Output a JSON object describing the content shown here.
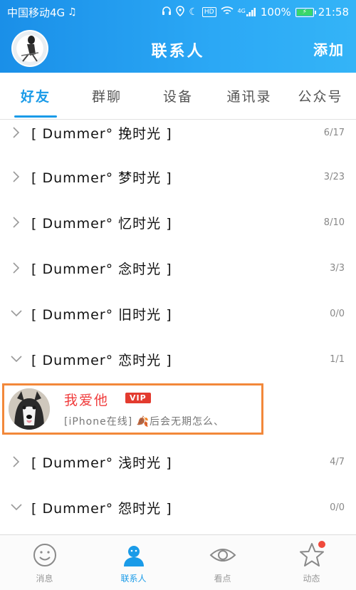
{
  "status_bar": {
    "carrier": "中国移动4G",
    "music_icon": "music-note-icon",
    "battery": "100%",
    "network": "4G",
    "hd": "HD",
    "time": "21:58"
  },
  "header": {
    "title": "联系人",
    "add_label": "添加"
  },
  "tabs": [
    {
      "label": "好友",
      "active": true
    },
    {
      "label": "群聊",
      "active": false
    },
    {
      "label": "设备",
      "active": false
    },
    {
      "label": "通讯录",
      "active": false
    },
    {
      "label": "公众号",
      "active": false
    }
  ],
  "groups": [
    {
      "name": "[ Dummer° 挽时光 ]",
      "count": "6/17",
      "expanded": false
    },
    {
      "name": "[ Dummer° 梦时光 ]",
      "count": "3/23",
      "expanded": false
    },
    {
      "name": "[ Dummer° 忆时光 ]",
      "count": "8/10",
      "expanded": false
    },
    {
      "name": "[ Dummer° 念时光 ]",
      "count": "3/3",
      "expanded": false
    },
    {
      "name": "[ Dummer° 旧时光 ]",
      "count": "0/0",
      "expanded": true
    },
    {
      "name": "[ Dummer° 恋时光 ]",
      "count": "1/1",
      "expanded": true
    },
    {
      "name": "[ Dummer° 浅时光 ]",
      "count": "4/7",
      "expanded": false
    },
    {
      "name": "[ Dummer° 怨时光 ]",
      "count": "0/0",
      "expanded": true
    }
  ],
  "friend": {
    "name": "我爱他",
    "badge": "VIP",
    "status": "[iPhone在线] 🍂后会无期怎么、"
  },
  "bottom_nav": [
    {
      "label": "消息",
      "icon": "smile-face-icon",
      "active": false
    },
    {
      "label": "联系人",
      "icon": "contact-person-icon",
      "active": true
    },
    {
      "label": "看点",
      "icon": "eye-icon",
      "active": false
    },
    {
      "label": "动态",
      "icon": "star-icon",
      "active": false
    }
  ],
  "colors": {
    "accent": "#1a9be8",
    "highlight_border": "#f2883a",
    "vip_red": "#e33b2f",
    "friend_name": "#f03c3c"
  }
}
